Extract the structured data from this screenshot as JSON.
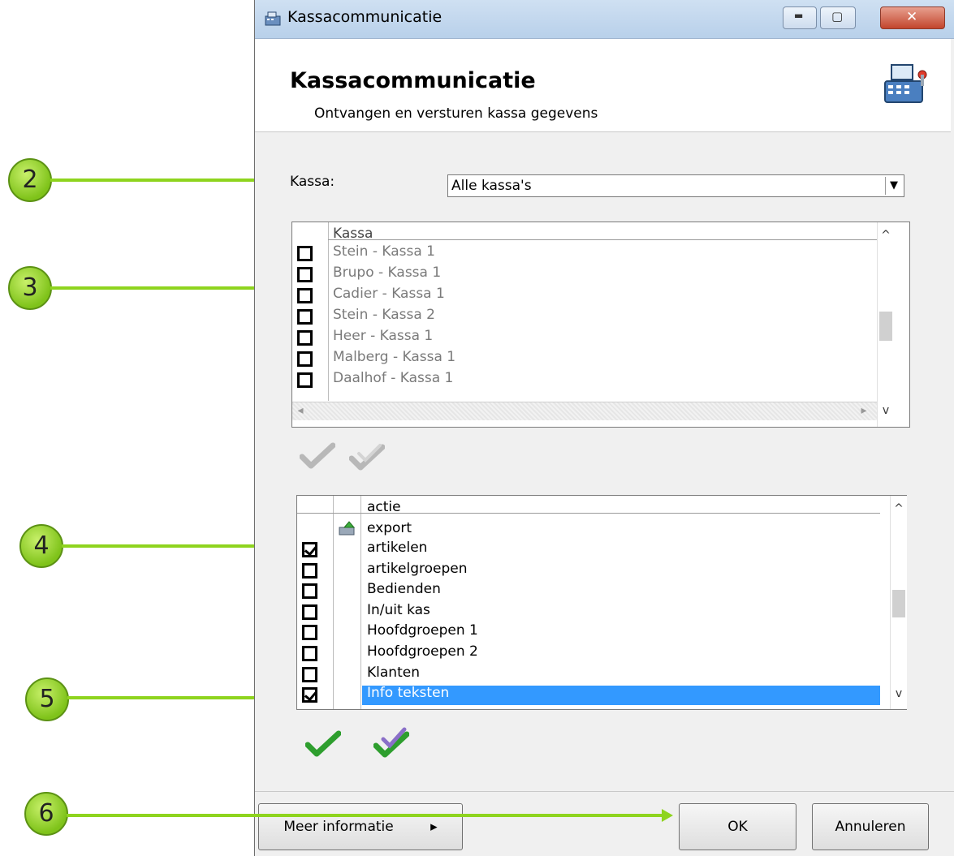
{
  "window": {
    "title": "Kassacommunicatie",
    "min_glyph": "▬",
    "max_glyph": "▢",
    "close_glyph": "✕"
  },
  "header": {
    "title": "Kassacommunicatie",
    "subtitle": "Ontvangen en versturen kassa gegevens",
    "icon": "cash-register-icon"
  },
  "kassa_filter": {
    "label": "Kassa:",
    "value": "Alle kassa's"
  },
  "kassa_grid": {
    "column": "Kassa",
    "rows": [
      {
        "label": "Stein - Kassa 1",
        "checked": false
      },
      {
        "label": "Brupo - Kassa 1",
        "checked": false
      },
      {
        "label": "Cadier - Kassa 1",
        "checked": false
      },
      {
        "label": "Stein - Kassa 2",
        "checked": false
      },
      {
        "label": "Heer - Kassa 1",
        "checked": false
      },
      {
        "label": "Malberg - Kassa 1",
        "checked": false
      },
      {
        "label": "Daalhof - Kassa 1",
        "checked": false
      }
    ]
  },
  "actie_grid": {
    "column": "actie",
    "group_label": "export",
    "rows": [
      {
        "label": "artikelen",
        "checked": true
      },
      {
        "label": "artikelgroepen",
        "checked": false
      },
      {
        "label": "Bedienden",
        "checked": false
      },
      {
        "label": "In/uit kas",
        "checked": false
      },
      {
        "label": "Hoofdgroepen 1",
        "checked": false
      },
      {
        "label": "Hoofdgroepen 2",
        "checked": false
      },
      {
        "label": "Klanten",
        "checked": false
      },
      {
        "label": "Info teksten",
        "checked": true,
        "selected": true
      }
    ]
  },
  "buttons": {
    "more_info": "Meer informatie",
    "more_info_arrow": "▸",
    "ok": "OK",
    "cancel": "Annuleren"
  },
  "callouts": [
    "2",
    "3",
    "4",
    "5",
    "6"
  ],
  "scroll": {
    "up": "^",
    "down": "v",
    "left": "◂",
    "right": "▸",
    "dropdown": "▼"
  },
  "colors": {
    "accent_green": "#8ed41e",
    "selection": "#3399ff"
  }
}
